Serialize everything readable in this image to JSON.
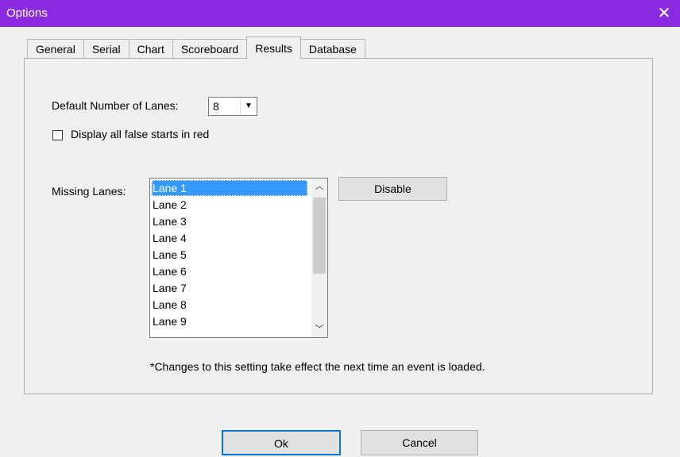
{
  "window": {
    "title": "Options",
    "close_glyph": "✕"
  },
  "tabs": [
    {
      "label": "General",
      "active": false
    },
    {
      "label": "Serial",
      "active": false
    },
    {
      "label": "Chart",
      "active": false
    },
    {
      "label": "Scoreboard",
      "active": false
    },
    {
      "label": "Results",
      "active": true
    },
    {
      "label": "Database",
      "active": false
    }
  ],
  "results": {
    "default_lanes_label": "Default Number of Lanes:",
    "default_lanes_value": "8",
    "false_starts_label": "Display all false starts in red",
    "false_starts_checked": false,
    "missing_lanes_label": "Missing Lanes:",
    "lanes": [
      "Lane 1",
      "Lane 2",
      "Lane 3",
      "Lane 4",
      "Lane 5",
      "Lane 6",
      "Lane 7",
      "Lane 8",
      "Lane 9"
    ],
    "selected_lane": "Lane 1",
    "disable_label": "Disable",
    "note": "*Changes to this setting take effect the next time an event is loaded."
  },
  "footer": {
    "ok_label": "Ok",
    "cancel_label": "Cancel"
  },
  "colors": {
    "titlebar": "#8a2be2",
    "selection": "#3399ff",
    "focus": "#0078d7"
  },
  "icons": {
    "close": "close-icon",
    "dropdown": "chevron-down-icon",
    "scroll_up": "chevron-up-icon",
    "scroll_down": "chevron-down-icon"
  }
}
